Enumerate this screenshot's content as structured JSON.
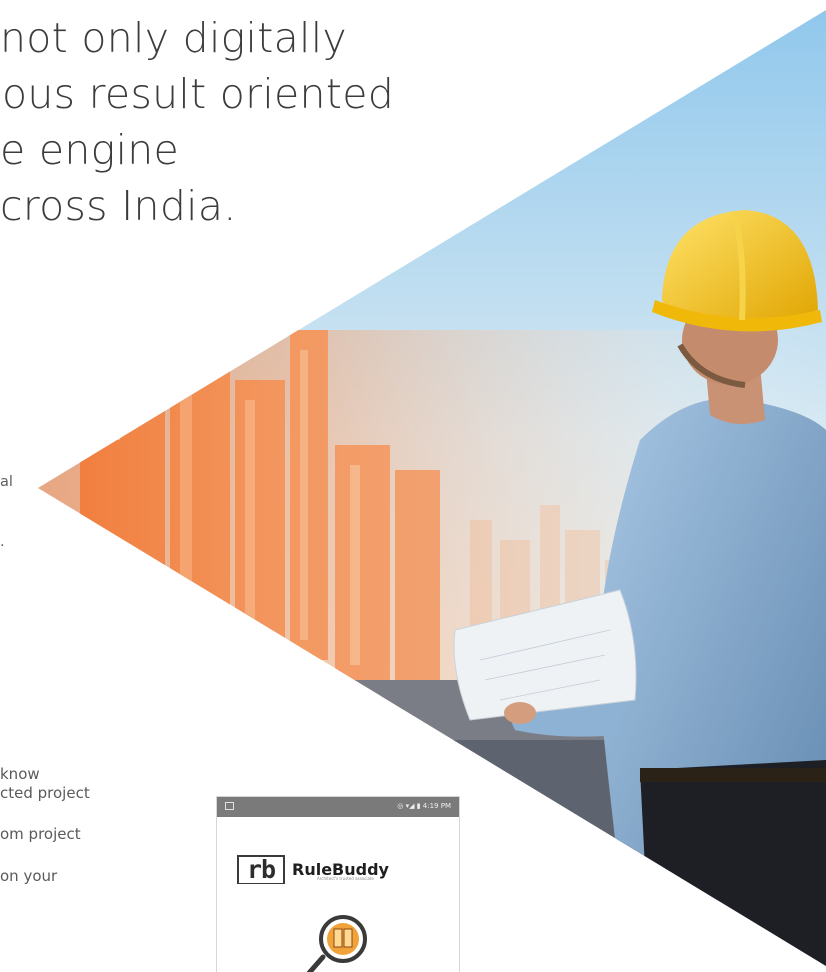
{
  "headline": {
    "line1": "not only digitally",
    "line2": "ous result oriented",
    "line3": "e engine",
    "line4": "cross India."
  },
  "body_fragments": {
    "frag1": "al",
    "frag2": "."
  },
  "list_items": [
    "know",
    "cted project",
    "om project",
    "on your"
  ],
  "phone": {
    "status_time": "4:19 PM",
    "logo_mark": "rb",
    "brand_name": "RuleBuddy",
    "tagline": "Architect's trusted associate"
  },
  "icons": {
    "status_left": "image-icon",
    "status_right": "signal-battery-icons",
    "app_icon": "book-search-icon"
  }
}
